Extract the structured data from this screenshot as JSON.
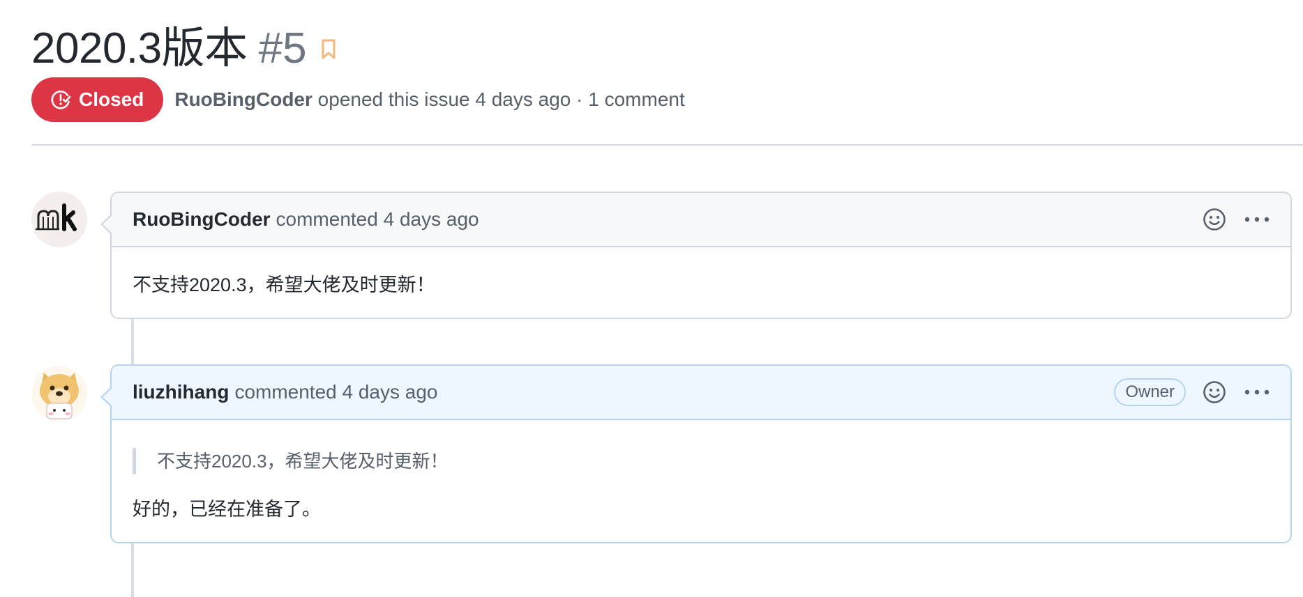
{
  "issue": {
    "title": "2020.3版本",
    "number": "#5",
    "state_label": "Closed",
    "state_color": "#dc3545",
    "author": "RuoBingCoder",
    "opened_text": "opened this issue 4 days ago · 1 comment"
  },
  "comments": [
    {
      "author": "RuoBingCoder",
      "action": "commented 4 days ago",
      "avatar": "mk-logo-avatar",
      "body": "不支持2020.3，希望大佬及时更新！"
    },
    {
      "author": "liuzhihang",
      "action": "commented 4 days ago",
      "badge": "Owner",
      "avatar": "doge-avatar",
      "quote": "不支持2020.3，希望大佬及时更新！",
      "body": "好的，已经在准备了。"
    }
  ],
  "icons": {
    "bookmark": "bookmark-icon",
    "closed": "issue-closed-icon",
    "reaction": "smiley-icon",
    "more": "kebab-horizontal-icon"
  }
}
